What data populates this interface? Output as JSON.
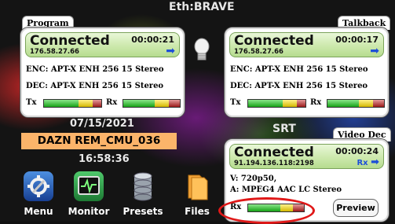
{
  "header": {
    "title": "Eth:BRAVE"
  },
  "program": {
    "tab": "Program",
    "state": "Connected",
    "timer": "00:00:21",
    "ip": "176.58.27.66",
    "enc": "ENC: APT-X ENH 256 15 Stereo",
    "dec": "DEC: APT-X ENH 256 15 Stereo",
    "tx_label": "Tx",
    "rx_label": "Rx"
  },
  "talkback": {
    "tab": "Talkback",
    "state": "Connected",
    "timer": "00:00:17",
    "ip": "176.58.27.66",
    "enc": "ENC: APT-X ENH 256 15 Stereo",
    "dec": "DEC: APT-X ENH 256 15 Stereo",
    "tx_label": "Tx",
    "rx_label": "Rx"
  },
  "info": {
    "date": "07/15/2021",
    "show": "DAZN REM_CMU_036",
    "time": "16:58:36"
  },
  "srt": {
    "heading": "SRT",
    "tab": "Video Dec",
    "state": "Connected",
    "timer": "00:00:24",
    "ip": "91.194.136.118:2198",
    "rx_arrow": "Rx",
    "video": "V: 720p50,",
    "audio": "A: MPEG4 AAC LC Stereo",
    "rx_label": "Rx",
    "preview": "Preview"
  },
  "dock": [
    {
      "label": "Menu",
      "icon": "gear-icon"
    },
    {
      "label": "Monitor",
      "icon": "monitor-icon"
    },
    {
      "label": "Presets",
      "icon": "database-icon"
    },
    {
      "label": "Files",
      "icon": "folder-icon"
    }
  ],
  "colors": {
    "connected_green": "#cfeab0",
    "arrow_blue": "#1d4fd8",
    "show_banner": "#fbb46a",
    "highlight_red": "#e01818"
  }
}
